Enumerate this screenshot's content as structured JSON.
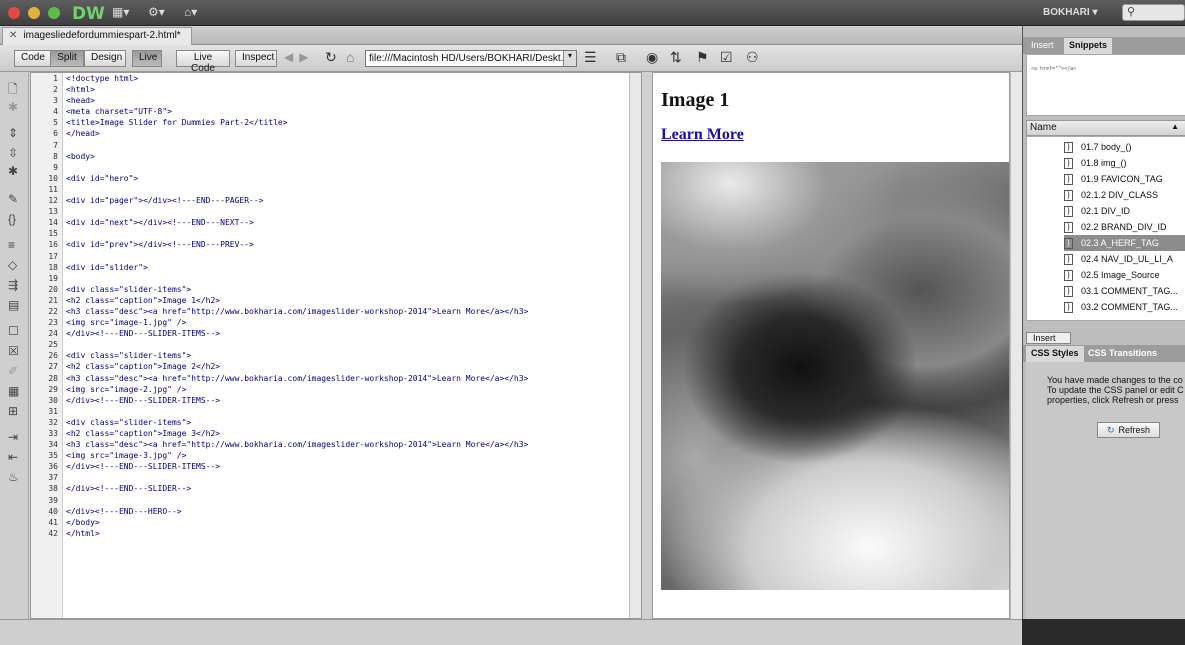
{
  "app": {
    "logo": "DW",
    "user": "BOKHARI"
  },
  "document": {
    "tab_title": "imagesliedefordummiespart-2.html*"
  },
  "toolbar": {
    "code": "Code",
    "split": "Split",
    "design": "Design",
    "live": "Live",
    "live_code": "Live Code",
    "inspect": "Inspect",
    "url": "file:///Macintosh HD/Users/BOKHARI/Deskt..."
  },
  "code_lines": [
    "<!doctype html>",
    "<html>",
    "<head>",
    "<meta charset=\"UTF-8\">",
    "<title>Image Slider for Dummies Part-2</title>",
    "</head>",
    "",
    "<body>",
    "",
    "<div id=\"hero\">",
    "",
    "<div id=\"pager\"></div><!---END---PAGER-->",
    "",
    "<div id=\"next\"></div><!---END---NEXT-->",
    "",
    "<div id=\"prev\"></div><!---END---PREV-->",
    "",
    "<div id=\"slider\">",
    "",
    "<div class=\"slider-items\">",
    "<h2 class=\"caption\">Image 1</h2>",
    "<h3 class=\"desc\"><a href=\"http://www.bokharia.com/imageslider-workshop-2014\">Learn More</a></h3>",
    "<img src=\"image-1.jpg\" />",
    "</div><!---END---SLIDER-ITEMS-->",
    "",
    "<div class=\"slider-items\">",
    "<h2 class=\"caption\">Image 2</h2>",
    "<h3 class=\"desc\"><a href=\"http://www.bokharia.com/imageslider-workshop-2014\">Learn More</a></h3>",
    "<img src=\"image-2.jpg\" />",
    "</div><!---END---SLIDER-ITEMS-->",
    "",
    "<div class=\"slider-items\">",
    "<h2 class=\"caption\">Image 3</h2>",
    "<h3 class=\"desc\"><a href=\"http://www.bokharia.com/imageslider-workshop-2014\">Learn More</a></h3>",
    "<img src=\"image-3.jpg\" />",
    "</div><!---END---SLIDER-ITEMS-->",
    "",
    "</div><!---END---SLIDER-->",
    "",
    "</div><!---END---HERO-->",
    "</body>",
    "</html>"
  ],
  "live_view": {
    "heading": "Image 1",
    "link": "Learn More"
  },
  "right_panel": {
    "tabs": [
      "Insert",
      "Snippets"
    ],
    "snippet_preview": "<a href=\"\"></a>",
    "name_header": "Name",
    "snippets": [
      "01.7 body_()",
      "01.8 img_()",
      "01.9 FAVICON_TAG",
      "02.1.2 DIV_CLASS",
      "02.1 DIV_ID",
      "02.2 BRAND_DIV_ID",
      "02.3 A_HERF_TAG",
      "02.4 NAV_ID_UL_LI_A",
      "02.5 Image_Source",
      "03.1 COMMENT_TAG...",
      "03.2 COMMENT_TAG..."
    ],
    "selected_snippet": 6,
    "insert": "Insert",
    "css_tabs": [
      "CSS Styles",
      "CSS Transitions"
    ],
    "css_message": "You have made changes to the co\nTo update the CSS panel or edit C\nproperties, click Refresh or press",
    "refresh": "Refresh"
  }
}
